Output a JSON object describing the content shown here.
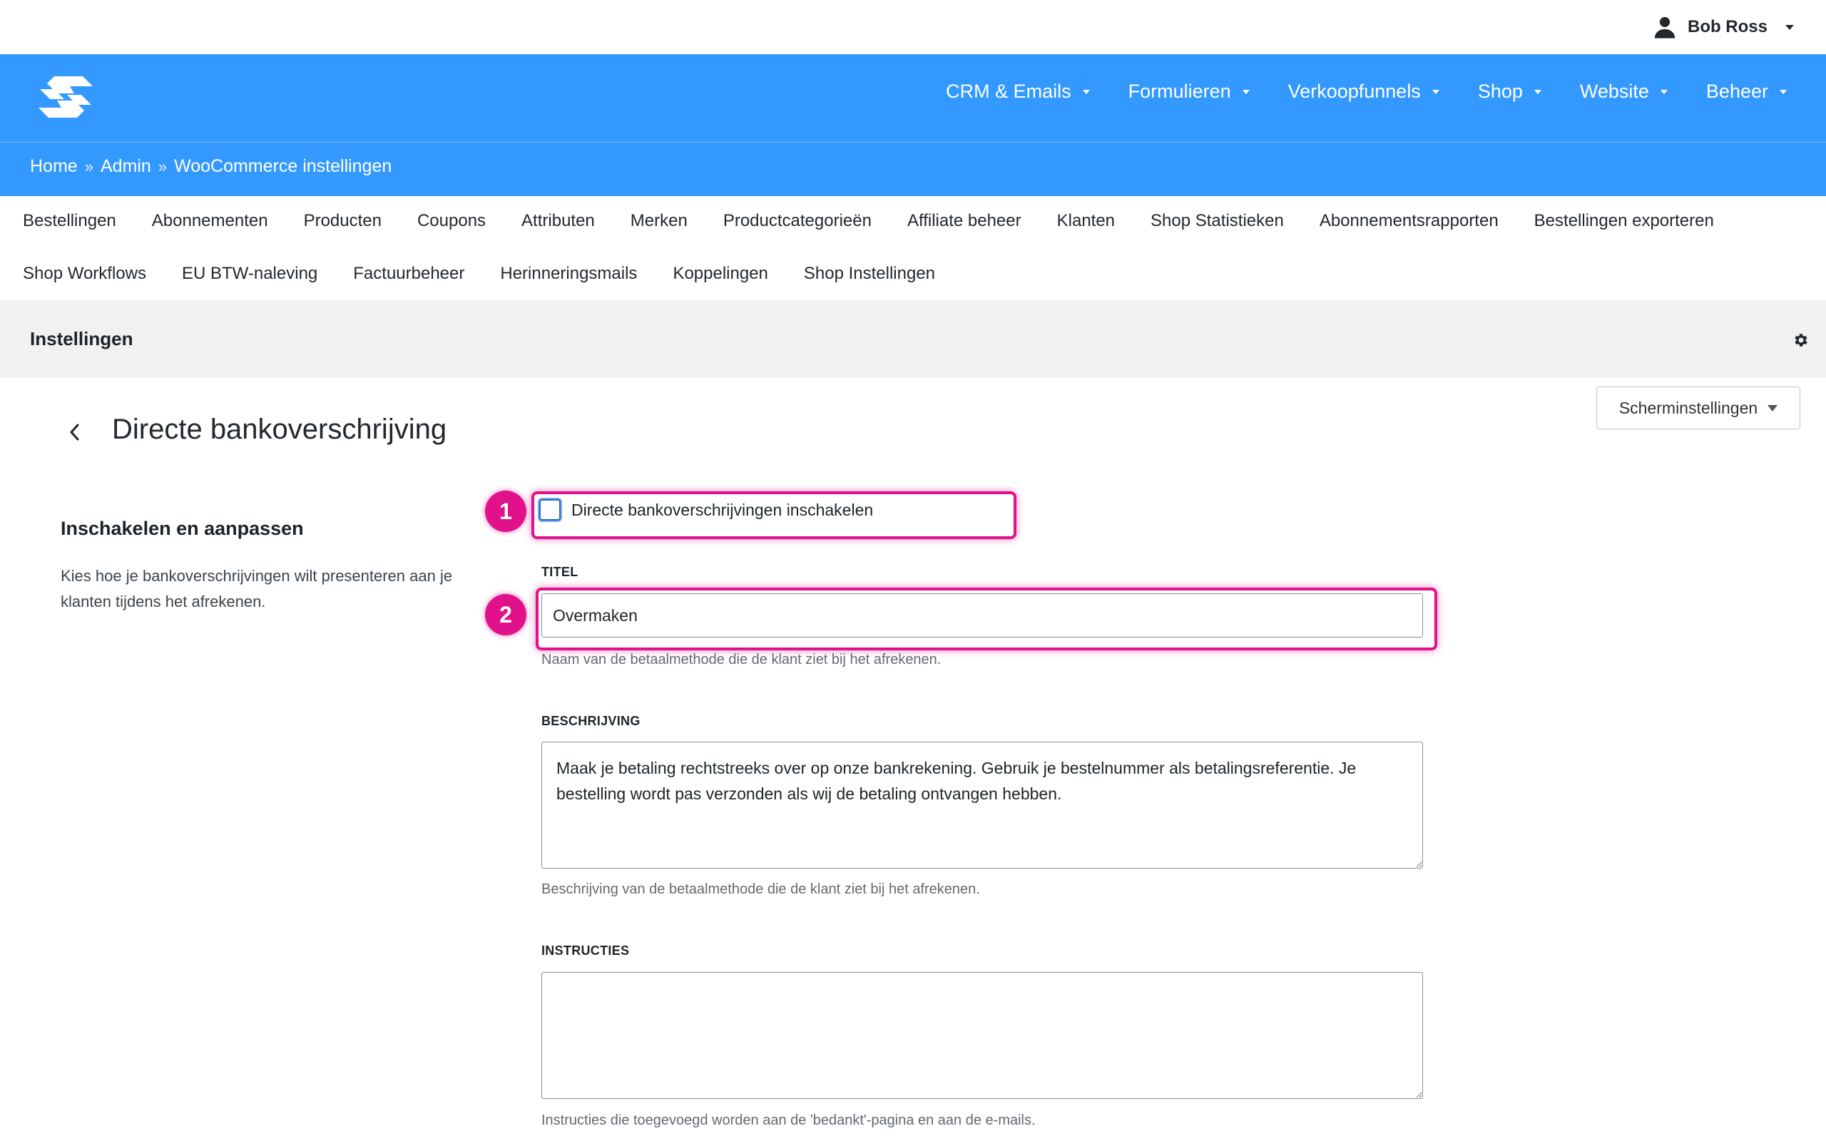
{
  "user": {
    "name": "Bob Ross"
  },
  "nav": {
    "items": [
      {
        "label": "CRM & Emails"
      },
      {
        "label": "Formulieren"
      },
      {
        "label": "Verkoopfunnels"
      },
      {
        "label": "Shop"
      },
      {
        "label": "Website"
      },
      {
        "label": "Beheer"
      }
    ]
  },
  "breadcrumb": [
    "Home",
    "Admin",
    "WooCommerce instellingen"
  ],
  "breadcrumb_separator": "»",
  "subnav": {
    "row1": [
      "Bestellingen",
      "Abonnementen",
      "Producten",
      "Coupons",
      "Attributen",
      "Merken",
      "Productcategorieën",
      "Affiliate beheer",
      "Klanten",
      "Shop Statistieken",
      "Abonnementsrapporten",
      "Bestellingen exporteren"
    ],
    "row2": [
      "Shop Workflows",
      "EU BTW-naleving",
      "Factuurbeheer",
      "Herinneringsmails",
      "Koppelingen",
      "Shop Instellingen"
    ]
  },
  "settings_bar": {
    "title": "Instellingen"
  },
  "screen_options": {
    "label": "Scherminstellingen"
  },
  "page": {
    "title": "Directe bankoverschrijving"
  },
  "section": {
    "title": "Inschakelen en aanpassen",
    "description": "Kies hoe je bankoverschrijvingen wilt presenteren aan je klanten tijdens het afrekenen."
  },
  "annotations": {
    "badge1": "1",
    "badge2": "2",
    "color": "#e0118a"
  },
  "form": {
    "enable": {
      "label": "Directe bankoverschrijvingen inschakelen",
      "checked": false
    },
    "title": {
      "label": "TITEL",
      "value": "Overmaken",
      "help": "Naam van de betaalmethode die de klant ziet bij het afrekenen."
    },
    "description": {
      "label": "BESCHRIJVING",
      "value": "Maak je betaling rechtstreeks over op onze bankrekening. Gebruik je bestelnummer als betalingsreferentie. Je bestelling wordt pas verzonden als wij de betaling ontvangen hebben.",
      "help": "Beschrijving van de betaalmethode die de klant ziet bij het afrekenen."
    },
    "instructions": {
      "label": "INSTRUCTIES",
      "value": "",
      "help": "Instructies die toegevoegd worden aan de 'bedankt'-pagina en aan de e-mails."
    }
  },
  "colors": {
    "header_blue": "#3399ff",
    "settings_bar": "#f1f1f1",
    "highlight": "#e0118a"
  }
}
